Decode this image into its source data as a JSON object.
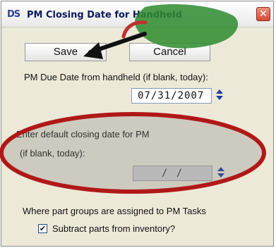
{
  "window": {
    "app_icon_text": "DS",
    "title": "PM Closing Date for Handheld",
    "close_glyph": "✕"
  },
  "buttons": {
    "save_label": "Save",
    "cancel_label": "Cancel"
  },
  "due_date": {
    "label": "PM Due Date from handheld (if blank, today):",
    "value": "07/31/2007"
  },
  "default_closing": {
    "label_line1": "Enter default closing date for PM",
    "label_line2": "(if blank, today):",
    "value": " /  / "
  },
  "part_groups": {
    "label": "Where part groups are assigned to PM Tasks",
    "checkbox_label": "Subtract parts from inventory?",
    "checkbox_checked": true,
    "check_glyph": "✔"
  },
  "icons": {
    "spinner": "date-spinner-icon",
    "annotation_arrow": "black-arrow",
    "annotation_blob": "green-highlight",
    "annotation_ellipse": "red-ellipse"
  },
  "colors": {
    "accent_red_ellipse": "#b01818",
    "accent_green_blob": "#2e8b2e",
    "dialog_background": "#ece9d8"
  }
}
